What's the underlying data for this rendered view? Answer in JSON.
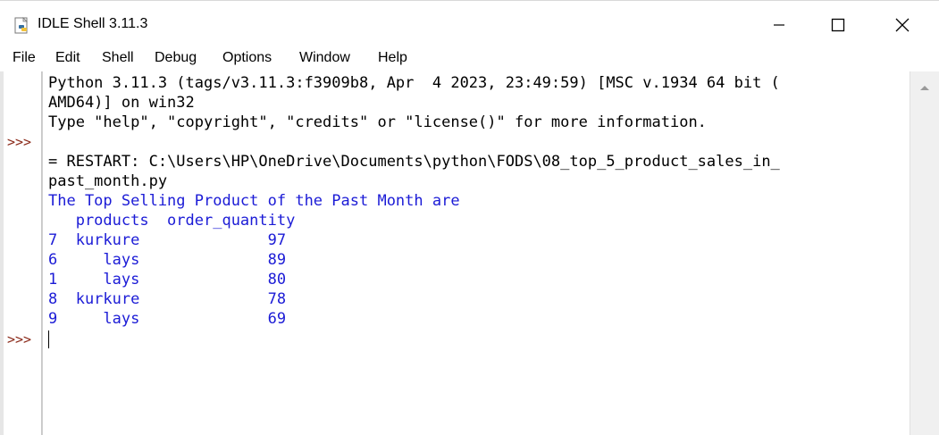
{
  "window": {
    "title": "IDLE Shell 3.11.3",
    "minimize_glyph": "minimize-icon",
    "maximize_glyph": "maximize-icon",
    "close_glyph": "close-icon"
  },
  "menu": {
    "items": [
      {
        "label": "File"
      },
      {
        "label": "Edit"
      },
      {
        "label": "Shell"
      },
      {
        "label": "Debug"
      },
      {
        "label": "Options"
      },
      {
        "label": "Window"
      },
      {
        "label": "Help"
      }
    ]
  },
  "shell": {
    "prompt": ">>>",
    "lines": [
      {
        "text": "Python 3.11.3 (tags/v3.11.3:f3909b8, Apr  4 2023, 23:49:59) [MSC v.1934 64 bit (",
        "style": "normal"
      },
      {
        "text": "AMD64)] on win32",
        "style": "normal"
      },
      {
        "text": "Type \"help\", \"copyright\", \"credits\" or \"license()\" for more information.",
        "style": "normal"
      },
      {
        "text": "",
        "style": "normal"
      },
      {
        "text": "= RESTART: C:\\Users\\HP\\OneDrive\\Documents\\python\\FODS\\08_top_5_product_sales_in_",
        "style": "normal"
      },
      {
        "text": "past_month.py",
        "style": "normal"
      },
      {
        "text": "The Top Selling Product of the Past Month are",
        "style": "blue"
      },
      {
        "text": "   products  order_quantity",
        "style": "blue"
      },
      {
        "text": "7  kurkure              97",
        "style": "blue"
      },
      {
        "text": "6     lays              89",
        "style": "blue"
      },
      {
        "text": "1     lays              80",
        "style": "blue"
      },
      {
        "text": "8  kurkure              78",
        "style": "blue"
      },
      {
        "text": "9     lays              69",
        "style": "blue"
      }
    ],
    "output_table": {
      "columns": [
        "products",
        "order_quantity"
      ],
      "rows": [
        {
          "index": "7",
          "products": "kurkure",
          "order_quantity": "97"
        },
        {
          "index": "6",
          "products": "lays",
          "order_quantity": "89"
        },
        {
          "index": "1",
          "products": "lays",
          "order_quantity": "80"
        },
        {
          "index": "8",
          "products": "kurkure",
          "order_quantity": "78"
        },
        {
          "index": "9",
          "products": "lays",
          "order_quantity": "69"
        }
      ]
    }
  },
  "colors": {
    "output_text": "#1b1bd6",
    "prompt": "#8b2a1a",
    "normal_text": "#000000"
  }
}
